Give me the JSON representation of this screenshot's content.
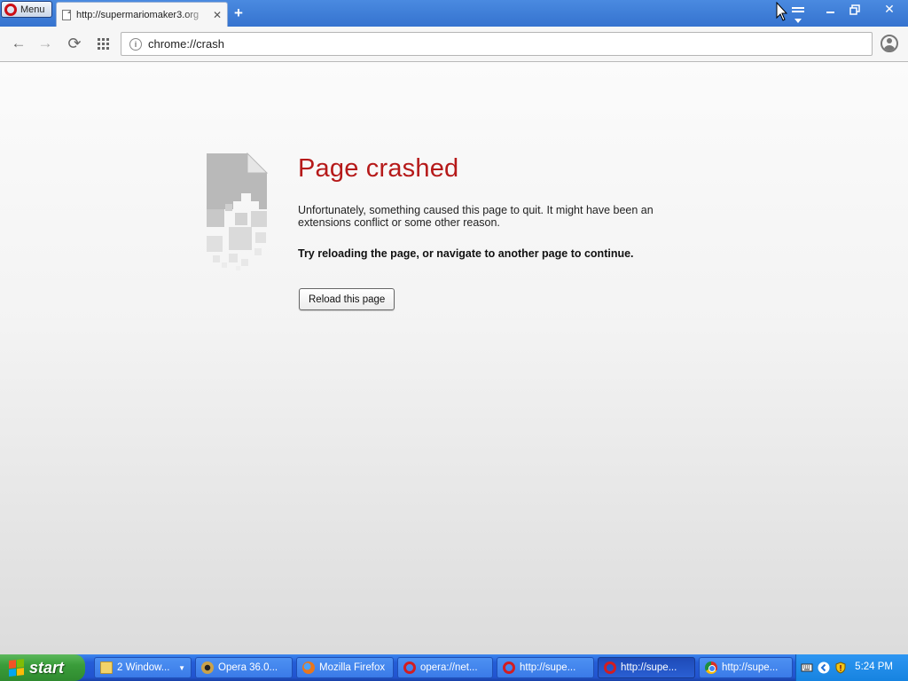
{
  "browser": {
    "menu_label": "Menu",
    "tab_title": "http://supermariomaker3.org",
    "url": "chrome://crash"
  },
  "error_page": {
    "title": "Page crashed",
    "message": "Unfortunately, something caused this page to quit. It might have been an extensions conflict or some other reason.",
    "hint": "Try reloading the page, or navigate to another page to continue.",
    "reload_button": "Reload this page"
  },
  "taskbar": {
    "start_label": "start",
    "items": [
      {
        "label": "2 Window...",
        "icon": "folder-icon"
      },
      {
        "label": "Opera 36.0...",
        "icon": "app-icon"
      },
      {
        "label": "Mozilla Firefox",
        "icon": "firefox-icon"
      },
      {
        "label": "opera://net...",
        "icon": "opera-icon"
      },
      {
        "label": "http://supe...",
        "icon": "opera-icon"
      },
      {
        "label": "http://supe...",
        "icon": "opera-icon",
        "active": true
      },
      {
        "label": "http://supe...",
        "icon": "chrome-icon"
      }
    ],
    "clock": "5:24 PM"
  },
  "colors": {
    "title_red": "#b61a1a",
    "titlebar_blue": "#3a7ad3",
    "taskbar_blue": "#245dd7",
    "start_green": "#3a9d3a"
  }
}
